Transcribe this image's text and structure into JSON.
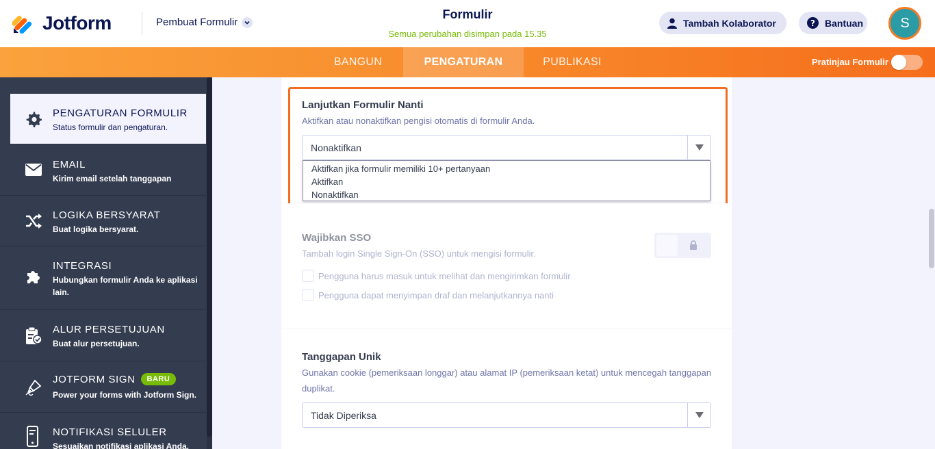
{
  "header": {
    "logo_text": "Jotform",
    "builder_menu": "Pembuat Formulir",
    "form_title": "Formulir",
    "save_status": "Semua perubahan disimpan pada 15.35",
    "collaborator_button": "Tambah Kolaborator",
    "help_button": "Bantuan",
    "avatar_initial": "S"
  },
  "nav": {
    "tabs": [
      {
        "label": "BANGUN"
      },
      {
        "label": "PENGATURAN"
      },
      {
        "label": "PUBLIKASI"
      }
    ],
    "preview_label": "Pratinjau Formulir",
    "preview_on": false
  },
  "sidebar": {
    "items": [
      {
        "title": "PENGATURAN FORMULIR",
        "desc": "Status formulir dan pengaturan.",
        "icon": "gear-icon",
        "active": true
      },
      {
        "title": "EMAIL",
        "desc": "Kirim email setelah tanggapan",
        "icon": "envelope-icon"
      },
      {
        "title": "LOGIKA BERSYARAT",
        "desc": "Buat logika bersyarat.",
        "icon": "shuffle-icon"
      },
      {
        "title": "INTEGRASI",
        "desc": "Hubungkan formulir Anda ke aplikasi lain.",
        "icon": "puzzle-icon"
      },
      {
        "title": "ALUR PERSETUJUAN",
        "desc": "Buat alur persetujuan.",
        "icon": "approval-icon"
      },
      {
        "title": "JOTFORM SIGN",
        "badge": "BARU",
        "desc": "Power your forms with Jotform Sign.",
        "icon": "pen-icon"
      },
      {
        "title": "NOTIFIKASI SELULER",
        "desc": "Sesuaikan notifikasi aplikasi Anda.",
        "icon": "mobile-icon"
      }
    ]
  },
  "main": {
    "continue_later": {
      "title": "Lanjutkan Formulir Nanti",
      "desc": "Aktifkan atau nonaktifkan pengisi otomatis di formulir Anda.",
      "selected": "Nonaktifkan",
      "options": [
        "Aktifkan jika formulir memiliki 10+ pertanyaan",
        "Aktifkan",
        "Nonaktifkan"
      ]
    },
    "sso": {
      "title": "Wajibkan SSO",
      "desc": "Tambah login Single Sign-On (SSO) untuk mengisi formulir.",
      "checkbox1": "Pengguna harus masuk untuk melihat dan mengirimkan formulir",
      "checkbox2": "Pengguna dapat menyimpan draf dan melanjutkannya nanti"
    },
    "unique": {
      "title": "Tanggapan Unik",
      "desc": "Gunakan cookie (pemeriksaan longgar) atau alamat IP (pemeriksaan ketat) untuk mencegah tanggapan duplikat.",
      "selected": "Tidak Diperiksa"
    }
  },
  "colors": {
    "brand_orange": "#f88b2c",
    "highlight": "#f26d21",
    "sidebar_bg": "#343c4f",
    "success_green": "#78bb07",
    "navy": "#0a1551"
  }
}
